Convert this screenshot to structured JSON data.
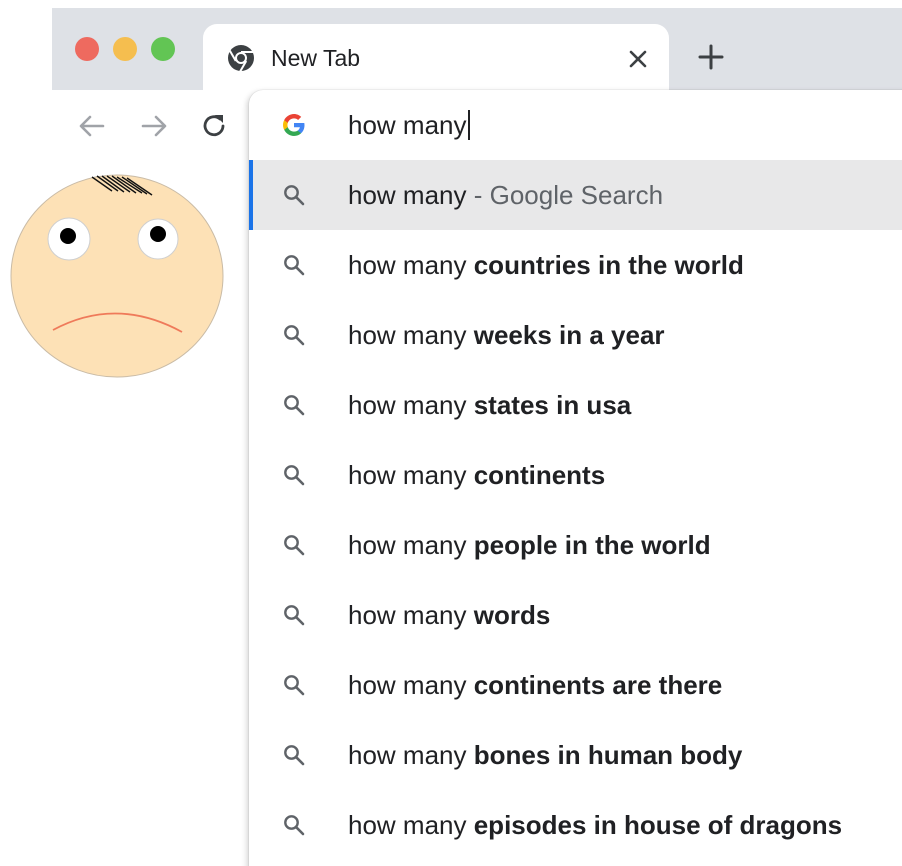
{
  "window": {
    "traffic_lights": [
      "close",
      "minimize",
      "zoom"
    ],
    "tab": {
      "title": "New Tab",
      "favicon": "chrome-icon"
    }
  },
  "toolbar": {
    "back_icon": "arrow-left-icon",
    "forward_icon": "arrow-right-icon",
    "reload_icon": "reload-icon"
  },
  "omnibox": {
    "value": "how many",
    "icon": "google-g-icon"
  },
  "suggestions": [
    {
      "prefix": "how many",
      "rest": " - Google Search",
      "style": "muted",
      "selected": true
    },
    {
      "prefix": "how many",
      "rest": " countries in the world",
      "style": "bold",
      "selected": false
    },
    {
      "prefix": "how many",
      "rest": " weeks in a year",
      "style": "bold",
      "selected": false
    },
    {
      "prefix": "how many",
      "rest": " states in usa",
      "style": "bold",
      "selected": false
    },
    {
      "prefix": "how many",
      "rest": " continents",
      "style": "bold",
      "selected": false
    },
    {
      "prefix": "how many",
      "rest": " people in the world",
      "style": "bold",
      "selected": false
    },
    {
      "prefix": "how many",
      "rest": " words",
      "style": "bold",
      "selected": false
    },
    {
      "prefix": "how many",
      "rest": " continents are there",
      "style": "bold",
      "selected": false
    },
    {
      "prefix": "how many",
      "rest": " bones in human body",
      "style": "bold",
      "selected": false
    },
    {
      "prefix": "how many",
      "rest": " episodes in house of dragons",
      "style": "bold",
      "selected": false
    }
  ],
  "colors": {
    "titlebar": "#dee1e6",
    "selected_row": "#e8e8e9",
    "selection_accent": "#1a73e8",
    "face_fill": "#fde1b6",
    "mouth": "#ef7a5a"
  }
}
